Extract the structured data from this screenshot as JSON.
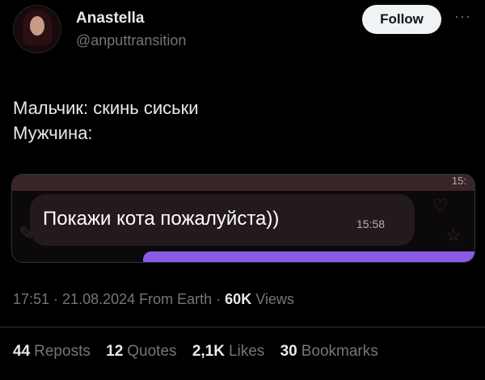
{
  "author": {
    "name": "Anastella",
    "handle": "@anputtransition"
  },
  "follow_label": "Follow",
  "more_label": "···",
  "tweet": {
    "lines": [
      "Мальчик: скинь сиськи",
      "Мужчина:"
    ]
  },
  "media": {
    "top_time": "15:",
    "message": "Покажи кота пожалуйста))",
    "message_time": "15:58"
  },
  "meta": {
    "time": "17:51",
    "sep1": " · ",
    "date": "21.08.2024",
    "source": " From Earth",
    "sep2": " · ",
    "views_count": "60K",
    "views_label": " Views"
  },
  "stats": [
    {
      "count": "44",
      "label": "Reposts"
    },
    {
      "count": "12",
      "label": "Quotes"
    },
    {
      "count": "2,1K",
      "label": "Likes"
    },
    {
      "count": "30",
      "label": "Bookmarks"
    }
  ],
  "colors": {
    "background": "#000000",
    "text": "#e7e9ea",
    "muted": "#71767b",
    "accent_purple": "#8a5ce6"
  }
}
